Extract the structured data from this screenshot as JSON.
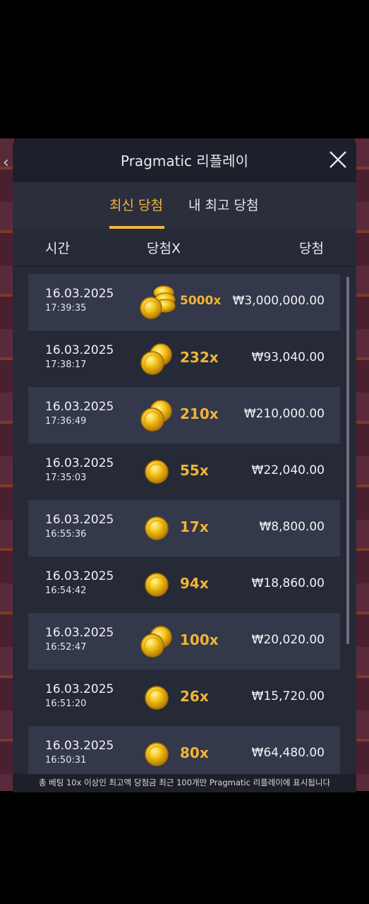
{
  "header": {
    "title": "Pragmatic 리플레이"
  },
  "tabs": [
    {
      "label": "최신 당첨",
      "active": true
    },
    {
      "label": "내 최고 당첨",
      "active": false
    }
  ],
  "columns": {
    "time": "시간",
    "multiplier": "당첨X",
    "win": "당첨"
  },
  "rows": [
    {
      "date": "16.03.2025",
      "time": "17:39:35",
      "multiplier": "5000x",
      "amount": "₩3,000,000.00",
      "coin_icon": "coin-stack-large"
    },
    {
      "date": "16.03.2025",
      "time": "17:38:17",
      "multiplier": "232x",
      "amount": "₩93,040.00",
      "coin_icon": "coin-pair"
    },
    {
      "date": "16.03.2025",
      "time": "17:36:49",
      "multiplier": "210x",
      "amount": "₩210,000.00",
      "coin_icon": "coin-pair"
    },
    {
      "date": "16.03.2025",
      "time": "17:35:03",
      "multiplier": "55x",
      "amount": "₩22,040.00",
      "coin_icon": "coin-single"
    },
    {
      "date": "16.03.2025",
      "time": "16:55:36",
      "multiplier": "17x",
      "amount": "₩8,800.00",
      "coin_icon": "coin-single"
    },
    {
      "date": "16.03.2025",
      "time": "16:54:42",
      "multiplier": "94x",
      "amount": "₩18,860.00",
      "coin_icon": "coin-single"
    },
    {
      "date": "16.03.2025",
      "time": "16:52:47",
      "multiplier": "100x",
      "amount": "₩20,020.00",
      "coin_icon": "coin-pair"
    },
    {
      "date": "16.03.2025",
      "time": "16:51:20",
      "multiplier": "26x",
      "amount": "₩15,720.00",
      "coin_icon": "coin-single"
    },
    {
      "date": "16.03.2025",
      "time": "16:50:31",
      "multiplier": "80x",
      "amount": "₩64,480.00",
      "coin_icon": "coin-single"
    }
  ],
  "footnote": "총 베팅 10x 이상인 최고액 당첨금 최근 100개만 Pragmatic 리플레이에 표시됩니다",
  "colors": {
    "accent": "#f4b63a",
    "panel": "#262a36",
    "row_alt": "#33384a"
  }
}
